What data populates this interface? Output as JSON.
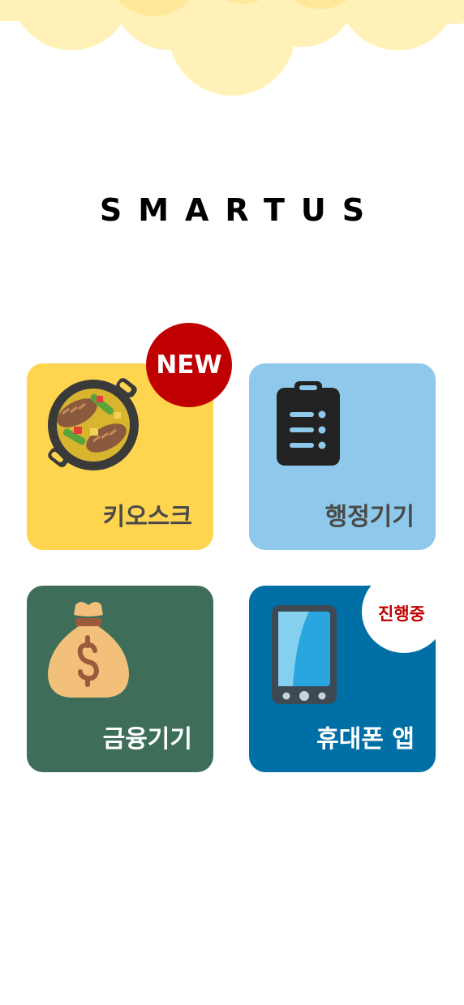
{
  "header": {
    "app_title": "SMARTUS"
  },
  "colors": {
    "cloud": "#fff1b8",
    "cloud_dark": "#ffe89a",
    "kiosk": "#ffd54f",
    "admin": "#8ec8ea",
    "finance": "#3e6e5a",
    "mobile": "#006fa5",
    "badge_red": "#c00000"
  },
  "tiles": [
    {
      "label": "키오스크",
      "icon": "cooking-pan-icon",
      "badge": "NEW"
    },
    {
      "label": "행정기기",
      "icon": "clipboard-icon",
      "badge": ""
    },
    {
      "label": "금융기기",
      "icon": "money-bag-icon",
      "badge": ""
    },
    {
      "label": "휴대폰 앱",
      "icon": "mobile-phone-icon",
      "badge": "진행중"
    }
  ]
}
